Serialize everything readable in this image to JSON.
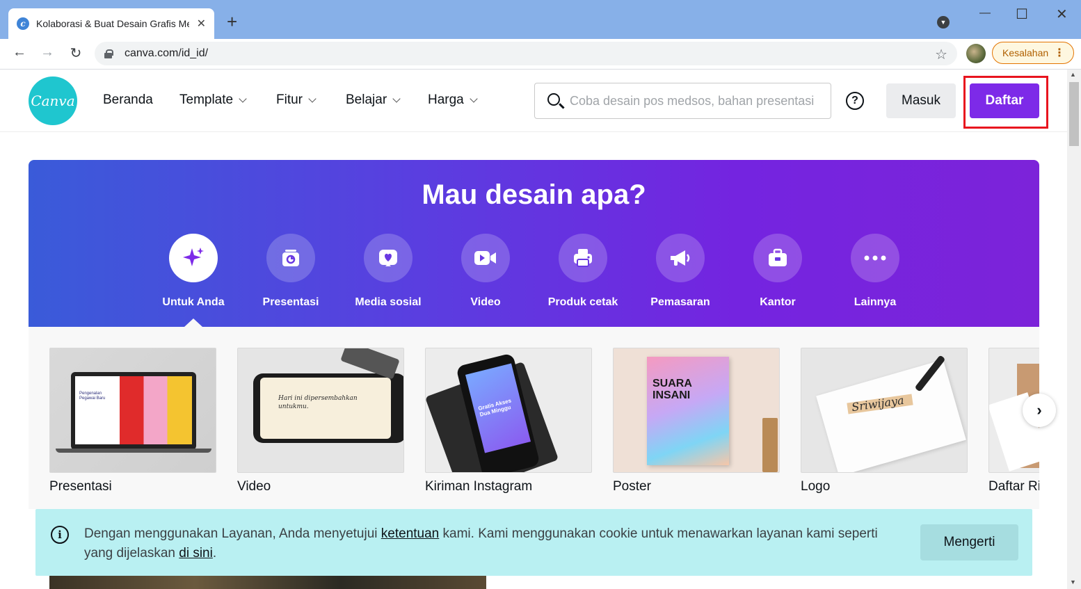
{
  "browser": {
    "tab_title": "Kolaborasi & Buat Desain Grafis Menarik",
    "tab_close": "✕",
    "new_tab": "+",
    "url": "canva.com/id_id/",
    "profile_error": "Kesalahan",
    "icons": [
      "back-icon",
      "forward-icon",
      "reload-icon",
      "lock-icon",
      "star-icon",
      "kebab-icon"
    ]
  },
  "header": {
    "logo_text": "Canva",
    "nav": [
      {
        "label": "Beranda"
      },
      {
        "label": "Template"
      },
      {
        "label": "Fitur"
      },
      {
        "label": "Belajar"
      },
      {
        "label": "Harga"
      }
    ],
    "search_placeholder": "Coba desain pos medsos, bahan presentasi",
    "help": "?",
    "login": "Masuk",
    "signup": "Daftar"
  },
  "hero": {
    "title": "Mau desain apa?",
    "categories": [
      {
        "label": "Untuk Anda",
        "icon": "sparkle-icon",
        "active": true
      },
      {
        "label": "Presentasi",
        "icon": "presentation-icon"
      },
      {
        "label": "Media sosial",
        "icon": "heart-icon"
      },
      {
        "label": "Video",
        "icon": "video-camera-icon"
      },
      {
        "label": "Produk cetak",
        "icon": "printer-icon"
      },
      {
        "label": "Pemasaran",
        "icon": "megaphone-icon"
      },
      {
        "label": "Kantor",
        "icon": "briefcase-icon"
      },
      {
        "label": "Lainnya",
        "icon": "more-icon"
      }
    ]
  },
  "cards": [
    {
      "label": "Presentasi",
      "thumb_text": "Pengenalan Pegawai Baru"
    },
    {
      "label": "Video",
      "thumb_text": "Hari ini dipersembahkan untukmu."
    },
    {
      "label": "Kiriman Instagram",
      "thumb_text": "Gratis Akses Dua Minggu"
    },
    {
      "label": "Poster",
      "thumb_text": "SUARA INSANI"
    },
    {
      "label": "Logo",
      "thumb_text": "Sriwijaya"
    },
    {
      "label": "Daftar Riwayat Hidup",
      "thumb_text": ""
    }
  ],
  "cookie": {
    "text_before": "Dengan menggunakan Layanan, Anda menyetujui ",
    "link1": "ketentuan",
    "text_middle": " kami. Kami menggunakan cookie untuk menawarkan layanan kami seperti yang dijelaskan ",
    "link2": "di sini",
    "text_after": ".",
    "button": "Mengerti"
  },
  "colors": {
    "brand_purple": "#7d2ae8",
    "logo_teal": "#1fc6cf",
    "cookie_bg": "#b9f0f2",
    "highlight": "#e8141e"
  }
}
